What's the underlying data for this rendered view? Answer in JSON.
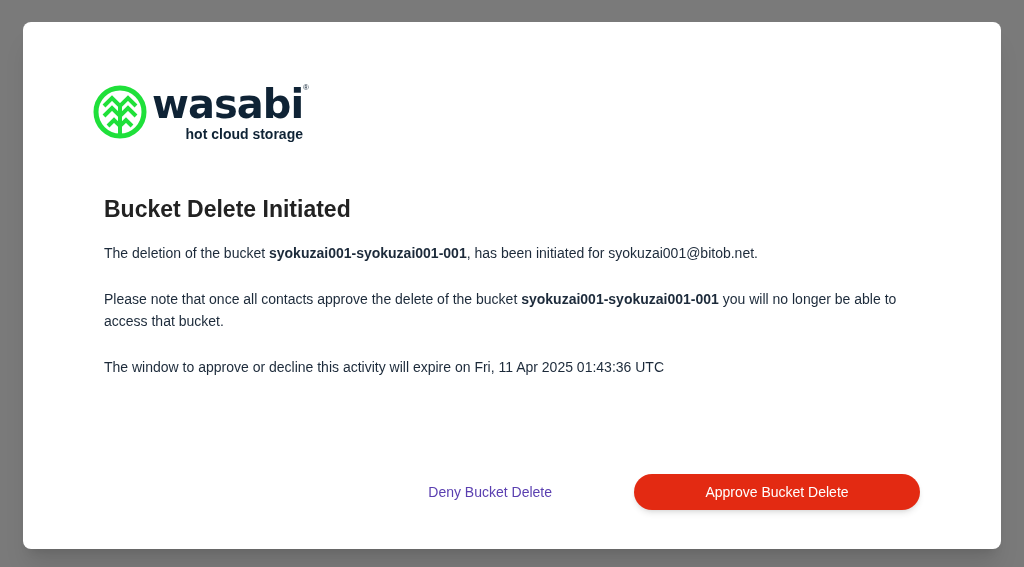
{
  "logo": {
    "name": "wasabi",
    "registered": "®",
    "tagline": "hot cloud storage"
  },
  "dialog": {
    "title": "Bucket Delete Initiated",
    "paragraphs": [
      "The deletion of the bucket **syokuzai001-syokuzai001-001**, has been initiated for syokuzai001@bitob.net.",
      "Please note that once all contacts approve the delete of the bucket **syokuzai001-syokuzai001-001** you will no longer be able to access that bucket.",
      "The window to approve or decline this activity will expire on Fri, 11 Apr 2025 01:43:36 UTC"
    ],
    "buttons": [
      {
        "label": "Deny Bucket Delete",
        "kind": "link"
      },
      {
        "label": "Approve Bucket Delete",
        "kind": "primary"
      }
    ]
  }
}
